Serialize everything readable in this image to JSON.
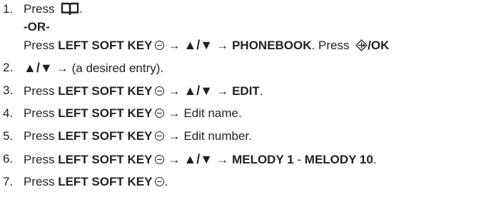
{
  "steps": [
    {
      "num": "1.",
      "press": "Press",
      "suffix": "."
    },
    {
      "or": "-OR-"
    },
    {
      "press": "Press",
      "key": "LEFT SOFT KEY",
      "updown": "▲/▼",
      "menu": "PHONEBOOK",
      "tail": ". Press",
      "ok": "/OK"
    },
    {
      "num": "2.",
      "updown": "▲/▼",
      "text": "(a desired entry)."
    },
    {
      "num": "3.",
      "press": "Press",
      "key": "LEFT SOFT KEY",
      "updown": "▲/▼",
      "menu": "EDIT",
      "tail": "."
    },
    {
      "num": "4.",
      "press": "Press",
      "key": "LEFT SOFT KEY",
      "text": "Edit name."
    },
    {
      "num": "5.",
      "press": "Press",
      "key": "LEFT SOFT KEY",
      "text": "Edit number."
    },
    {
      "num": "6.",
      "press": "Press",
      "key": "LEFT SOFT KEY",
      "updown": "▲/▼",
      "menu_a": "MELODY 1",
      "dash": " - ",
      "menu_b": "MELODY 10",
      "tail": "."
    },
    {
      "num": "7.",
      "press": "Press",
      "key": "LEFT SOFT KEY",
      "tail": "."
    }
  ],
  "arrow": "→",
  "icons": {
    "book": "phonebook-book-icon",
    "softkey": "left-soft-key-icon",
    "nav": "navigation-key-icon"
  }
}
